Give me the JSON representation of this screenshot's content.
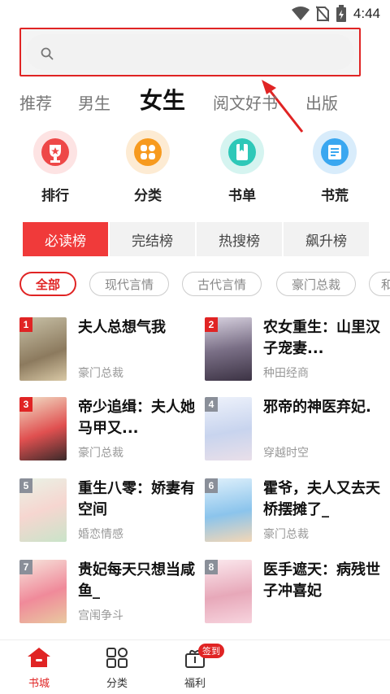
{
  "status_bar": {
    "time": "4:44"
  },
  "search": {
    "placeholder": ""
  },
  "top_tabs": [
    {
      "label": "推荐"
    },
    {
      "label": "男生"
    },
    {
      "label": "女生"
    },
    {
      "label": "阅文好书"
    },
    {
      "label": "出版"
    }
  ],
  "shortcuts": [
    {
      "label": "排行",
      "icon": "trophy-icon",
      "color": "#ee4848"
    },
    {
      "label": "分类",
      "icon": "category-grid-icon",
      "color": "#f79a1e"
    },
    {
      "label": "书单",
      "icon": "book-list-icon",
      "color": "#2ec8b8"
    },
    {
      "label": "书荒",
      "icon": "book-search-icon",
      "color": "#3aa7f0"
    }
  ],
  "rank_tabs": [
    {
      "label": "必读榜"
    },
    {
      "label": "完结榜"
    },
    {
      "label": "热搜榜"
    },
    {
      "label": "飙升榜"
    }
  ],
  "chips": [
    {
      "label": "全部"
    },
    {
      "label": "现代言情"
    },
    {
      "label": "古代言情"
    },
    {
      "label": "豪门总裁"
    },
    {
      "label": "和"
    }
  ],
  "books": [
    {
      "rank": "1",
      "title": "夫人总想气我",
      "tag": "豪门总裁"
    },
    {
      "rank": "2",
      "title": "农女重生：山里汉子宠妻...",
      "tag": "种田经商"
    },
    {
      "rank": "3",
      "title": "帝少追缉：夫人她马甲又...",
      "tag": "豪门总裁"
    },
    {
      "rank": "4",
      "title": "邪帝的神医弃妃.",
      "tag": "穿越时空"
    },
    {
      "rank": "5",
      "title": "重生八零：娇妻有空间",
      "tag": "婚恋情感"
    },
    {
      "rank": "6",
      "title": "霍爷，夫人又去天桥摆摊了_",
      "tag": "豪门总裁"
    },
    {
      "rank": "7",
      "title": "贵妃每天只想当咸鱼_",
      "tag": "宫闱争斗"
    },
    {
      "rank": "8",
      "title": "医手遮天：病残世子冲喜妃",
      "tag": ""
    }
  ],
  "bottom_nav": [
    {
      "label": "书城"
    },
    {
      "label": "分类"
    },
    {
      "label": "福利"
    }
  ],
  "welfare_badge": "签到",
  "colors": {
    "accent": "#e02424",
    "rank_top": "#e02424",
    "rank_other": "#8a8f99"
  }
}
